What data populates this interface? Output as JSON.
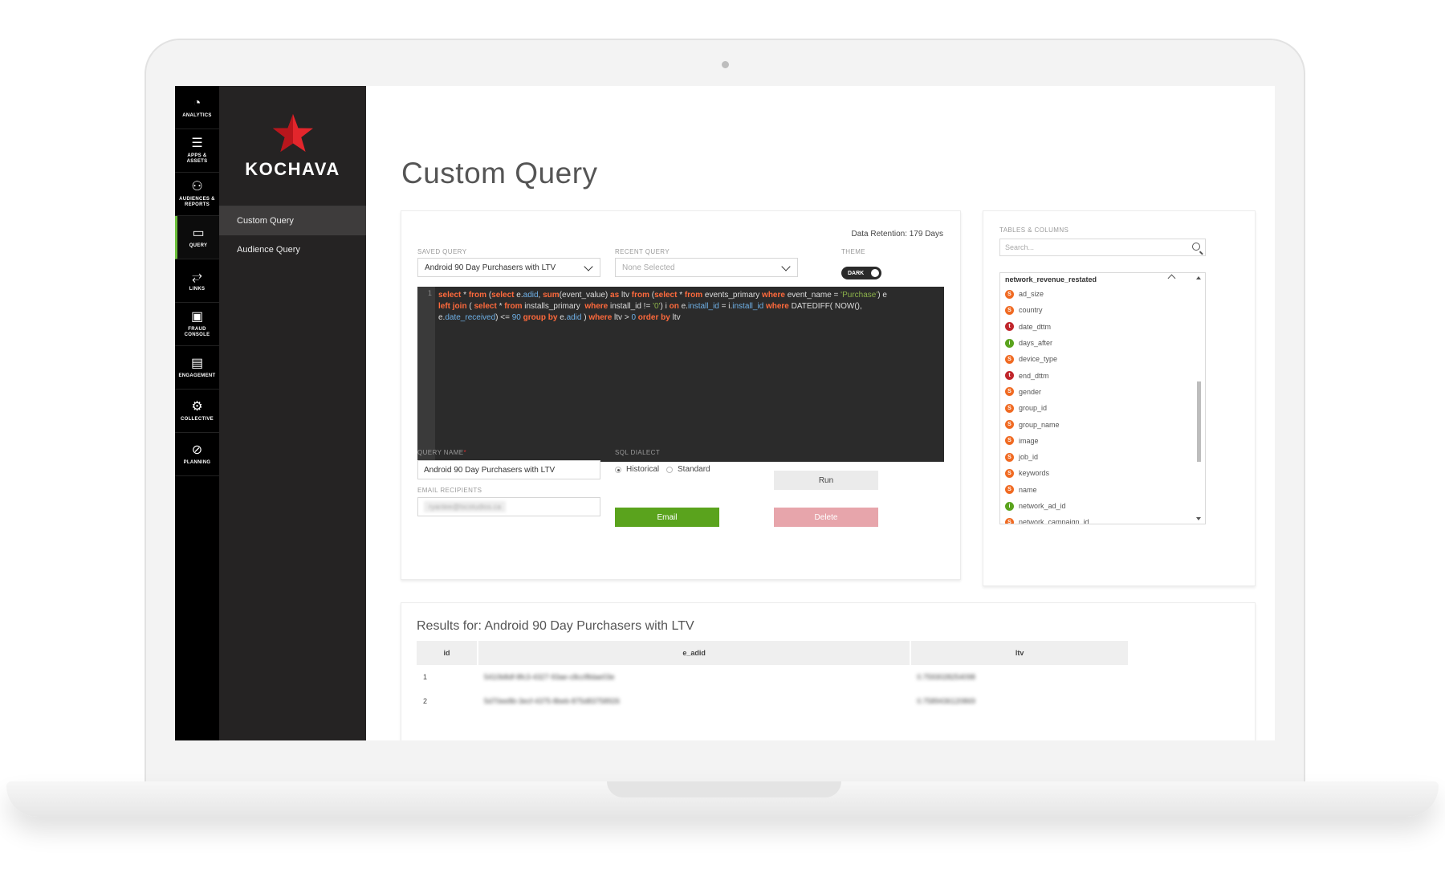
{
  "rail": [
    {
      "name": "analytics",
      "icon": "◔",
      "label": "ANALYTICS"
    },
    {
      "name": "apps-assets",
      "icon": "☰",
      "label": "APPS &\nASSETS"
    },
    {
      "name": "audiences-reports",
      "icon": "⚇",
      "label": "AUDIENCES &\nREPORTS"
    },
    {
      "name": "query",
      "icon": "▭",
      "label": "QUERY"
    },
    {
      "name": "links",
      "icon": "⥂",
      "label": "LINKS"
    },
    {
      "name": "fraud-console",
      "icon": "▣",
      "label": "FRAUD\nCONSOLE"
    },
    {
      "name": "engagement",
      "icon": "▤",
      "label": "ENGAGEMENT"
    },
    {
      "name": "collective",
      "icon": "⚙",
      "label": "COLLECTIVE"
    },
    {
      "name": "planning",
      "icon": "⊘",
      "label": "PLANNING"
    }
  ],
  "brand": {
    "name": "KOCHAVA",
    "star_color": "#e3262c"
  },
  "nav": {
    "custom_query": "Custom Query",
    "audience_query": "Audience Query"
  },
  "page": {
    "title": "Custom Query"
  },
  "query_panel": {
    "retention": "Data Retention: 179 Days",
    "saved_query_label": "SAVED QUERY",
    "saved_query_value": "Android 90 Day Purchasers with LTV",
    "recent_query_label": "RECENT QUERY",
    "recent_query_placeholder": "None Selected",
    "theme_label": "THEME",
    "theme_value": "DARK",
    "line_number": "1",
    "query_name_label": "QUERY NAME",
    "query_name_required": "*",
    "query_name_value": "Android 90 Day Purchasers with LTV",
    "sql_dialect_label": "SQL DIALECT",
    "dialect_historical": "Historical",
    "dialect_standard": "Standard",
    "email_recipients_label": "EMAIL RECIPIENTS",
    "email_chip": "ryanlee@lscstudios.ca",
    "run_label": "Run",
    "email_label": "Email",
    "delete_label": "Delete"
  },
  "tables_panel": {
    "label": "TABLES & COLUMNS",
    "search_placeholder": "Search...",
    "table_name": "network_revenue_restated",
    "columns": [
      {
        "type": "S",
        "name": "ad_size",
        "color": "#f06a22"
      },
      {
        "type": "S",
        "name": "country",
        "color": "#f06a22"
      },
      {
        "type": "t",
        "name": "date_dttm",
        "color": "#c0262c"
      },
      {
        "type": "i",
        "name": "days_after",
        "color": "#5aa31d"
      },
      {
        "type": "S",
        "name": "device_type",
        "color": "#f06a22"
      },
      {
        "type": "t",
        "name": "end_dttm",
        "color": "#c0262c"
      },
      {
        "type": "S",
        "name": "gender",
        "color": "#f06a22"
      },
      {
        "type": "S",
        "name": "group_id",
        "color": "#f06a22"
      },
      {
        "type": "S",
        "name": "group_name",
        "color": "#f06a22"
      },
      {
        "type": "S",
        "name": "image",
        "color": "#f06a22"
      },
      {
        "type": "S",
        "name": "job_id",
        "color": "#f06a22"
      },
      {
        "type": "S",
        "name": "keywords",
        "color": "#f06a22"
      },
      {
        "type": "S",
        "name": "name",
        "color": "#f06a22"
      },
      {
        "type": "i",
        "name": "network_ad_id",
        "color": "#5aa31d"
      },
      {
        "type": "S",
        "name": "network_campaign_id",
        "color": "#f06a22"
      }
    ]
  },
  "results": {
    "title": "Results for: Android 90 Day Purchasers with LTV",
    "headers": [
      "id",
      "e_adid",
      "ltv"
    ],
    "rows": [
      [
        "1",
        "5410b8df-8fc3-4327-93ae-c8ccf8dae03e",
        "0.7593028254098"
      ],
      [
        "2",
        "5d70ee8b-3ecf-4375-8beb-875d83758926",
        "0.7589436120869"
      ]
    ]
  }
}
